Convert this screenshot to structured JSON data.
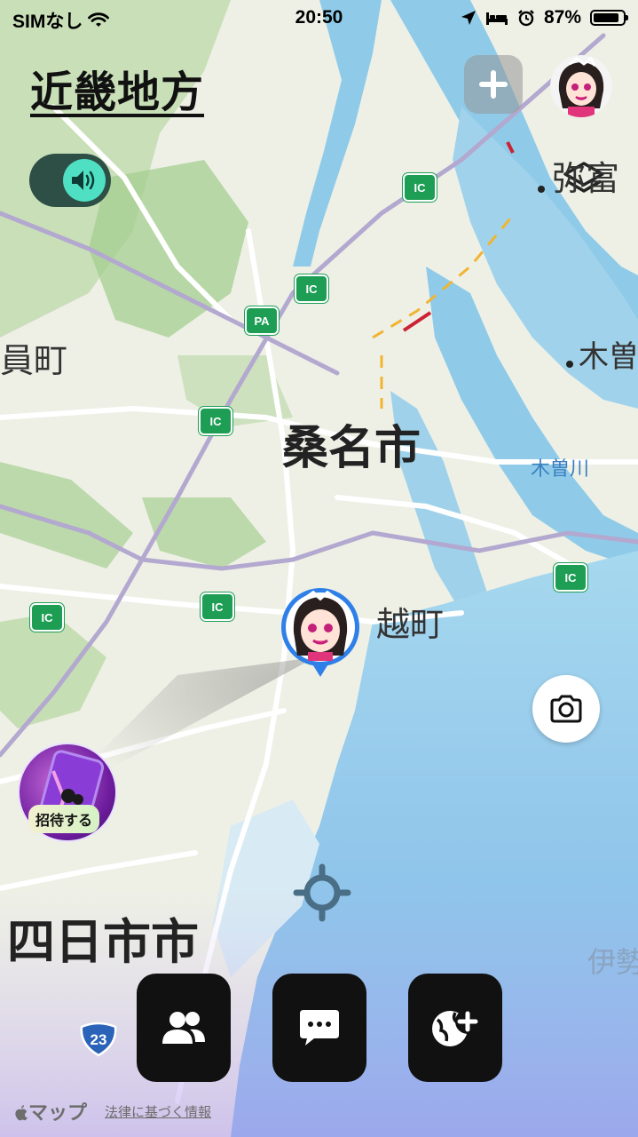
{
  "status_bar": {
    "carrier": "SIMなし",
    "time": "20:50",
    "battery_percent": "87%",
    "battery_level": 0.87,
    "icons": [
      "wifi-icon",
      "location-arrow-icon",
      "bed-icon",
      "alarm-icon",
      "battery-icon"
    ]
  },
  "header": {
    "region_title": "近畿地方"
  },
  "map": {
    "labels": {
      "kuwana": "桑名市",
      "yokkaichi": "四日市市",
      "kawagoe": "越町",
      "inabe": "員町",
      "yatomi": "弥富",
      "kiso": "木曽",
      "kisogawa": "木曽川",
      "ise": "伊勢"
    },
    "badges": {
      "ic": "IC",
      "pa": "PA",
      "route": "23"
    }
  },
  "invite": {
    "label": "招待する"
  },
  "footer": {
    "maps_brand": "マップ",
    "legal_link": "法律に基づく情報"
  },
  "colors": {
    "water": "#8fcbe8",
    "land": "#eef0e6",
    "green": "#a9d29a",
    "road": "#ffffff",
    "major_road": "#b3a8cf",
    "ic_green": "#1e9e55",
    "toggle_bg": "#2e4f45",
    "toggle_knob": "#4fe0c4"
  }
}
